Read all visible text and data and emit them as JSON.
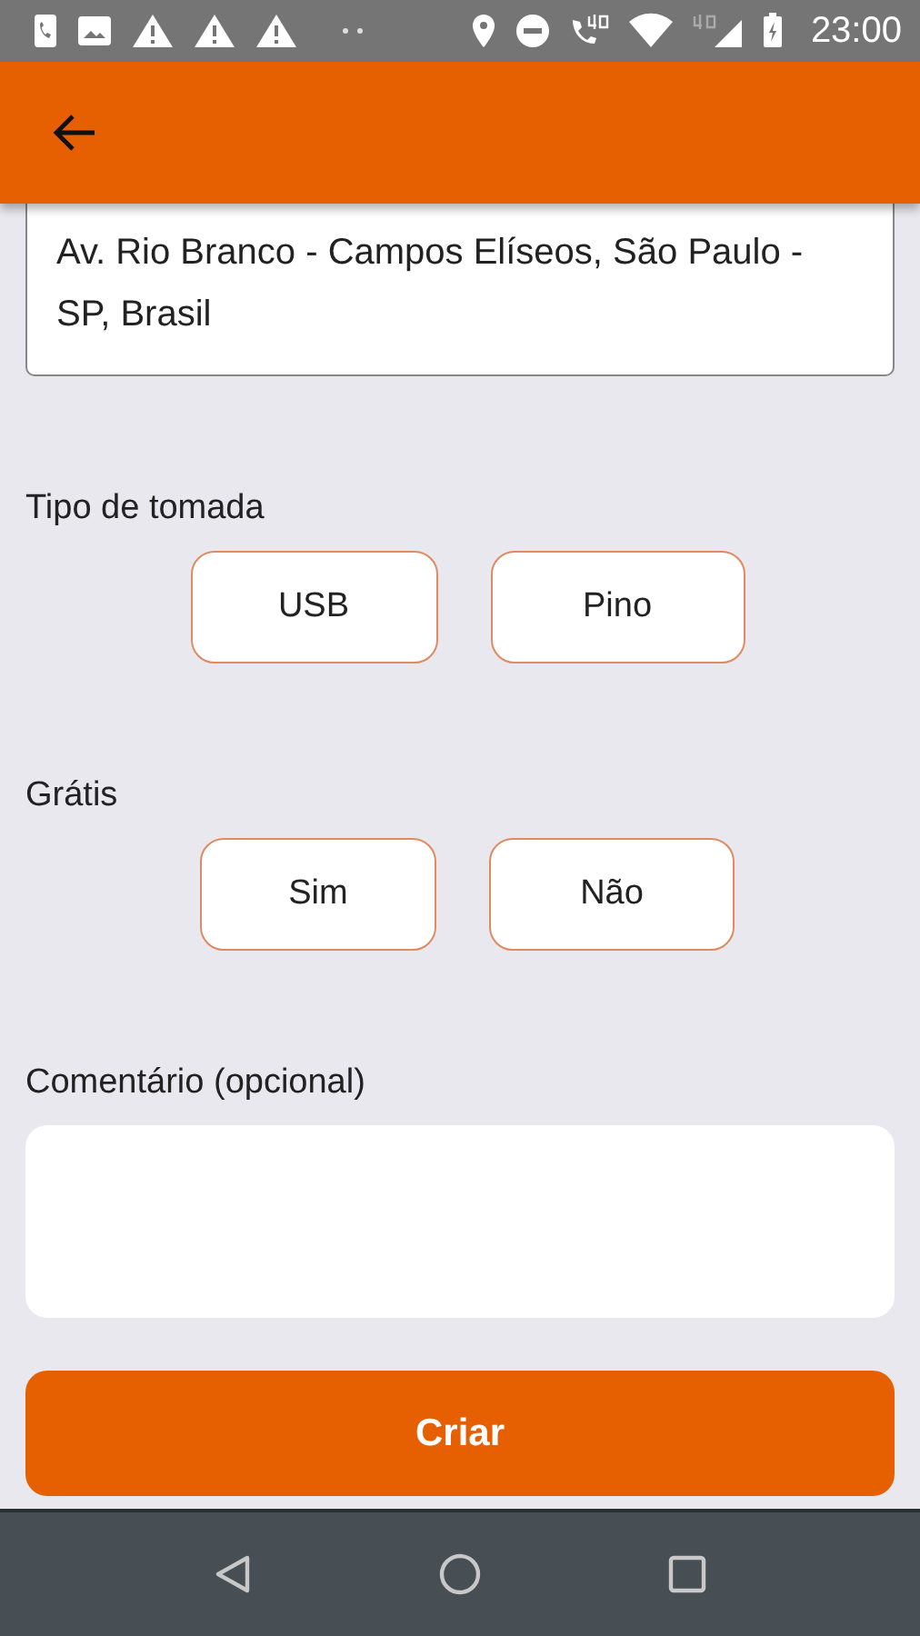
{
  "status_bar": {
    "time": "23:00"
  },
  "address": {
    "value": "Av. Rio Branco - Campos Elíseos, São Paulo - SP, Brasil"
  },
  "socket_type": {
    "label": "Tipo de tomada",
    "options": [
      {
        "label": "USB",
        "selected": false
      },
      {
        "label": "Pino",
        "selected": false
      }
    ]
  },
  "free": {
    "label": "Grátis",
    "options": [
      {
        "label": "Sim",
        "selected": false
      },
      {
        "label": "Não",
        "selected": false
      }
    ]
  },
  "comment": {
    "label": "Comentário (opcional)"
  },
  "submit": {
    "label": "Criar"
  }
}
